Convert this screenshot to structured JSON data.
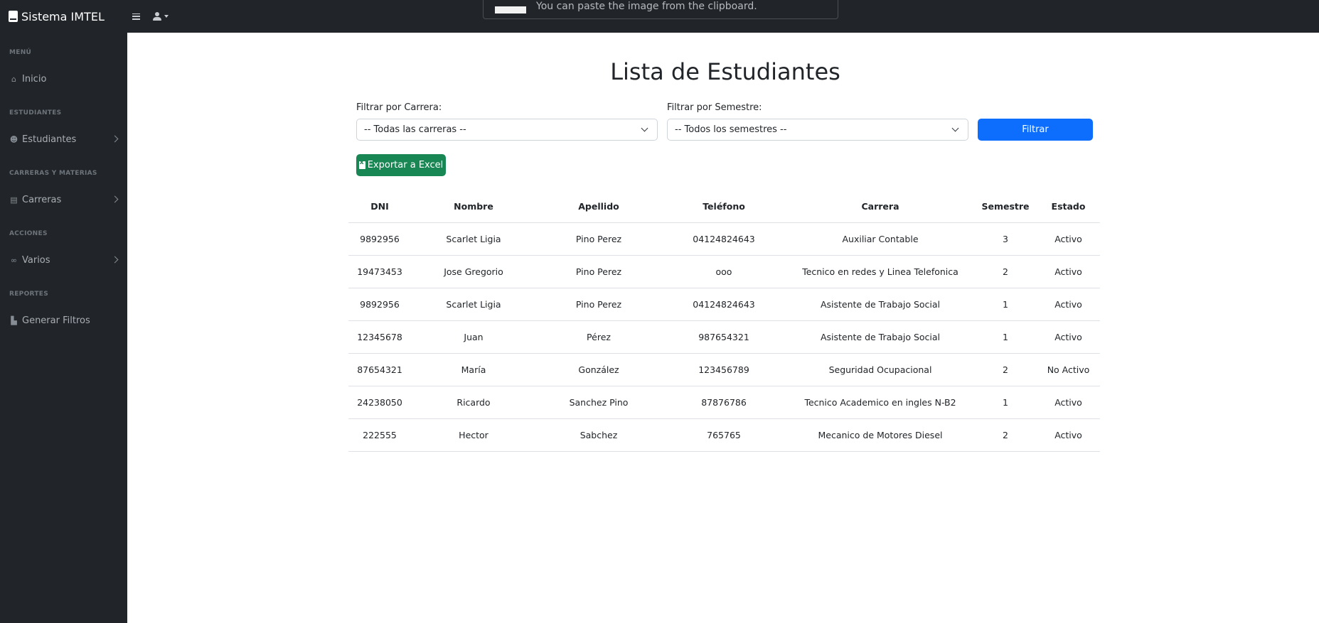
{
  "app": {
    "brand": "Sistema IMTEL"
  },
  "toast": {
    "message": "You can paste the image from the clipboard."
  },
  "sidebar": {
    "sections": [
      {
        "heading": "MENÚ",
        "item": {
          "label": "Inicio",
          "icon": "home-icon",
          "has_chevron": false
        }
      },
      {
        "heading": "ESTUDIANTES",
        "item": {
          "label": "Estudiantes",
          "icon": "users-icon",
          "has_chevron": true
        }
      },
      {
        "heading": "CARRERAS Y MATERIAS",
        "item": {
          "label": "Carreras",
          "icon": "book-icon",
          "has_chevron": true
        }
      },
      {
        "heading": "ACCIONES",
        "item": {
          "label": "Varios",
          "icon": "link-icon",
          "has_chevron": true
        }
      },
      {
        "heading": "REPORTES",
        "item": {
          "label": "Generar Filtros",
          "icon": "chart-icon",
          "has_chevron": false
        }
      }
    ]
  },
  "page": {
    "title": "Lista de Estudiantes"
  },
  "filters": {
    "carrera_label": "Filtrar por Carrera:",
    "carrera_value": "-- Todas las carreras --",
    "semestre_label": "Filtrar por Semestre:",
    "semestre_value": "-- Todos los semestres --",
    "filter_button": "Filtrar",
    "export_button": "Exportar a Excel"
  },
  "table": {
    "headers": [
      "DNI",
      "Nombre",
      "Apellido",
      "Teléfono",
      "Carrera",
      "Semestre",
      "Estado"
    ],
    "rows": [
      [
        "9892956",
        "Scarlet Ligia",
        "Pino Perez",
        "04124824643",
        "Auxiliar Contable",
        "3",
        "Activo"
      ],
      [
        "19473453",
        "Jose Gregorio",
        "Pino Perez",
        "ooo",
        "Tecnico en redes y Linea Telefonica",
        "2",
        "Activo"
      ],
      [
        "9892956",
        "Scarlet Ligia",
        "Pino Perez",
        "04124824643",
        "Asistente de Trabajo Social",
        "1",
        "Activo"
      ],
      [
        "12345678",
        "Juan",
        "Pérez",
        "987654321",
        "Asistente de Trabajo Social",
        "1",
        "Activo"
      ],
      [
        "87654321",
        "María",
        "González",
        "123456789",
        "Seguridad Ocupacional",
        "2",
        "No Activo"
      ],
      [
        "24238050",
        "Ricardo",
        "Sanchez Pino",
        "87876786",
        "Tecnico Academico en ingles N-B2",
        "1",
        "Activo"
      ],
      [
        "222555",
        "Hector",
        "Sabchez",
        "765765",
        "Mecanico de Motores Diesel",
        "2",
        "Activo"
      ]
    ]
  },
  "colors": {
    "sidebar_bg": "#212529",
    "primary": "#0d6efd",
    "success": "#198754"
  }
}
